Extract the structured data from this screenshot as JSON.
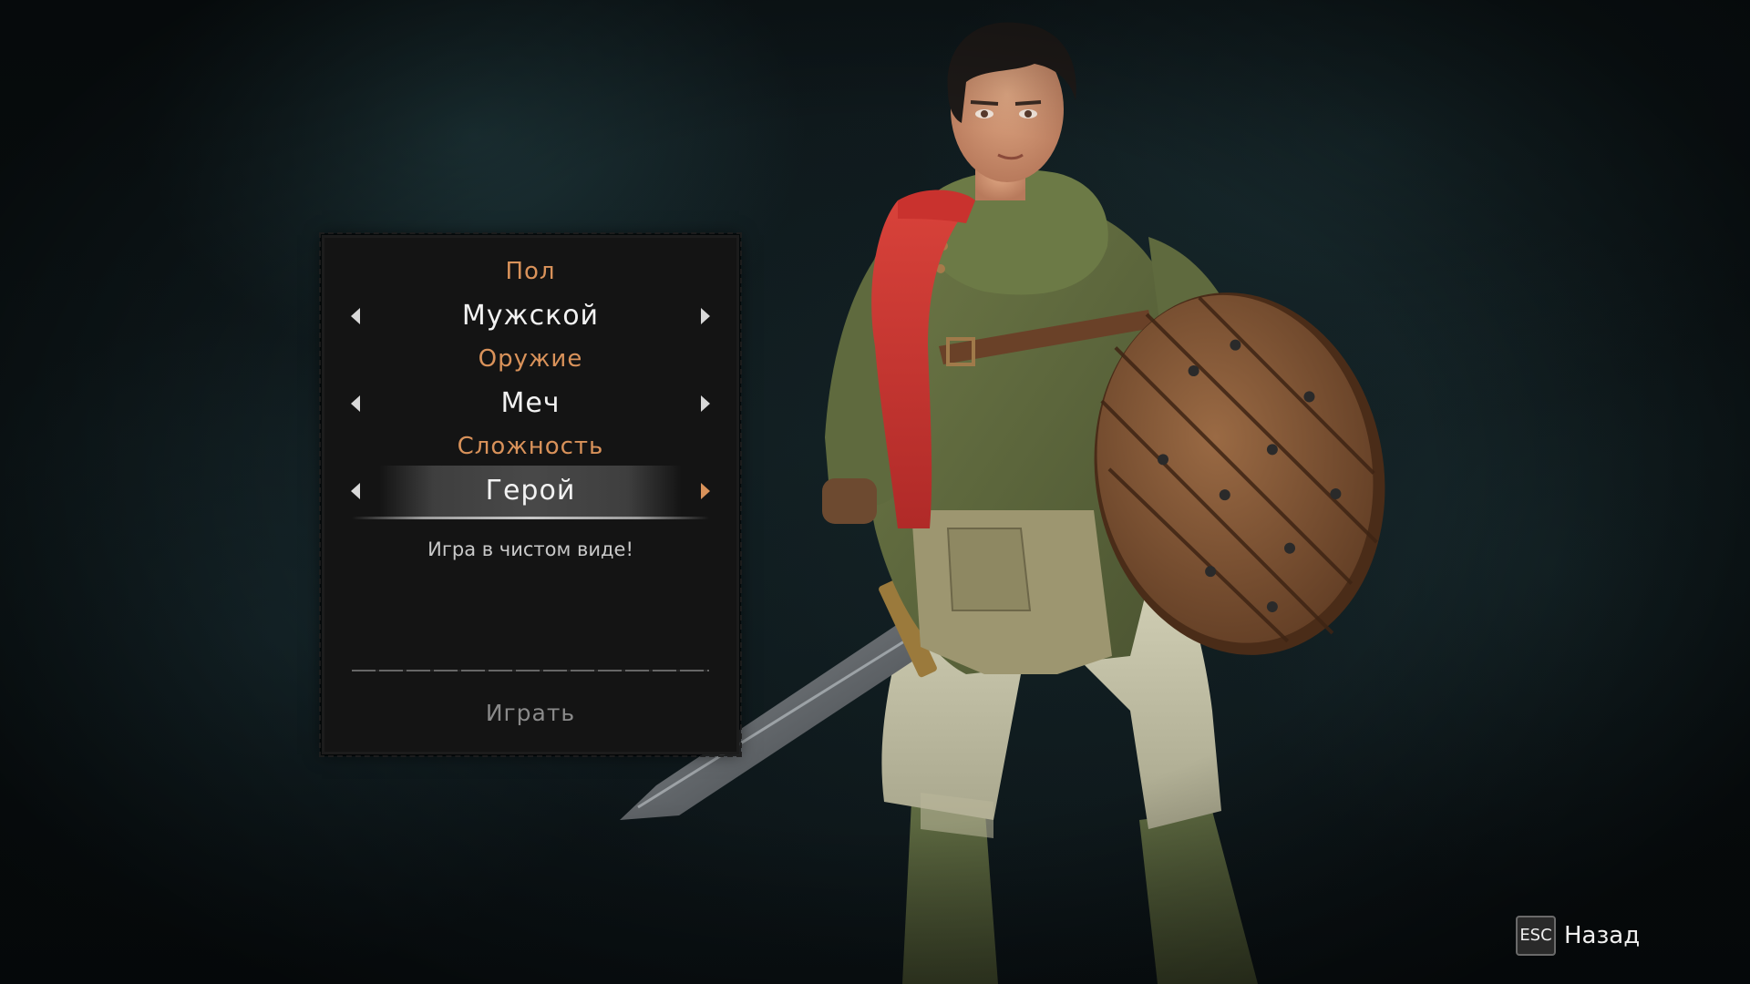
{
  "menu": {
    "fields": [
      {
        "label": "Пол",
        "value": "Мужской",
        "active": false
      },
      {
        "label": "Оружие",
        "value": "Меч",
        "active": false
      },
      {
        "label": "Сложность",
        "value": "Герой",
        "active": true
      }
    ],
    "description": "Игра в чистом виде!",
    "play_label": "Играть"
  },
  "footer": {
    "key_label": "ESC",
    "back_label": "Назад"
  },
  "colors": {
    "label_accent": "#d9925a",
    "value_text": "#f2f2f2",
    "panel_bg": "#141414",
    "disabled_text": "#8a8a8a"
  },
  "character": {
    "weapon": "sword-icon",
    "shield": "wooden-round-shield"
  }
}
